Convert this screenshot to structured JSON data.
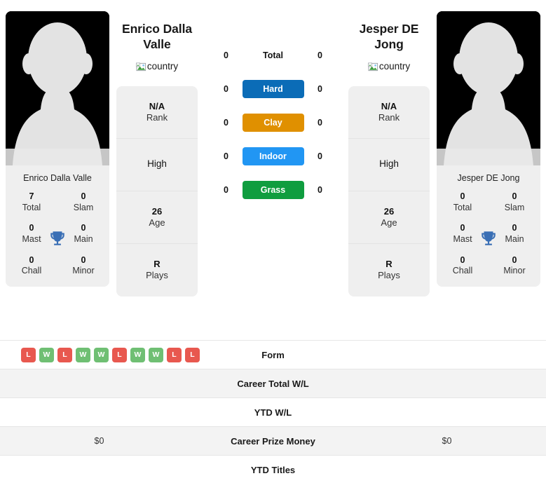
{
  "players": {
    "left": {
      "name": "Enrico Dalla Valle",
      "photo_caption": "Enrico Dalla Valle",
      "country_alt": "country",
      "titles": {
        "total_value": "7",
        "total_label": "Total",
        "slam_value": "0",
        "slam_label": "Slam",
        "mast_value": "0",
        "mast_label": "Mast",
        "main_value": "0",
        "main_label": "Main",
        "chall_value": "0",
        "chall_label": "Chall",
        "minor_value": "0",
        "minor_label": "Minor"
      },
      "details": {
        "rank_value": "N/A",
        "rank_label": "Rank",
        "high_value": "High",
        "age_value": "26",
        "age_label": "Age",
        "plays_value": "R",
        "plays_label": "Plays"
      }
    },
    "right": {
      "name": "Jesper DE Jong",
      "photo_caption": "Jesper DE Jong",
      "country_alt": "country",
      "titles": {
        "total_value": "0",
        "total_label": "Total",
        "slam_value": "0",
        "slam_label": "Slam",
        "mast_value": "0",
        "mast_label": "Mast",
        "main_value": "0",
        "main_label": "Main",
        "chall_value": "0",
        "chall_label": "Chall",
        "minor_value": "0",
        "minor_label": "Minor"
      },
      "details": {
        "rank_value": "N/A",
        "rank_label": "Rank",
        "high_value": "High",
        "age_value": "26",
        "age_label": "Age",
        "plays_value": "R",
        "plays_label": "Plays"
      }
    }
  },
  "head_to_head": {
    "rows": [
      {
        "left": "0",
        "label": "Total",
        "right": "0",
        "style": "plain",
        "color": ""
      },
      {
        "left": "0",
        "label": "Hard",
        "right": "0",
        "style": "pill",
        "color": "#0b6cb7"
      },
      {
        "left": "0",
        "label": "Clay",
        "right": "0",
        "style": "pill",
        "color": "#e09000"
      },
      {
        "left": "0",
        "label": "Indoor",
        "right": "0",
        "style": "pill",
        "color": "#2196f3"
      },
      {
        "left": "0",
        "label": "Grass",
        "right": "0",
        "style": "pill",
        "color": "#0f9d3f"
      }
    ]
  },
  "stats_table": {
    "form_label": "Form",
    "form_left": [
      "L",
      "W",
      "L",
      "W",
      "W",
      "L",
      "W",
      "W",
      "L",
      "L"
    ],
    "form_right": [],
    "badge_colors": {
      "W": "#6fbf73",
      "L": "#e8584f"
    },
    "rows": [
      {
        "left": "",
        "label": "Career Total W/L",
        "right": ""
      },
      {
        "left": "",
        "label": "YTD W/L",
        "right": ""
      },
      {
        "left": "$0",
        "label": "Career Prize Money",
        "right": "$0"
      },
      {
        "left": "",
        "label": "YTD Titles",
        "right": ""
      }
    ]
  }
}
